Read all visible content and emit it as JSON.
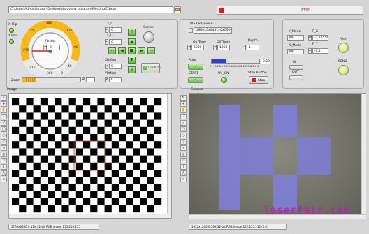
{
  "toolbar": {
    "file_path": "C:\\Users\\Administrator\\Desktop\\zhaoyang program\\Working\\C.bmp",
    "stop_label": "STOP"
  },
  "motion": {
    "x_flip_label": "X Flip",
    "y_flip_label": "Y Flip",
    "rotate_label": "Rotate",
    "rotate_value": "0",
    "dial_ticks": [
      "0",
      "45",
      "90",
      "135",
      "180",
      "225",
      "270",
      "315",
      "360"
    ],
    "zoom_label": "Zoom",
    "zoom_value": "1",
    "x_c_label": "X_C",
    "x_c_value": "0",
    "y_c_label": "Y_C",
    "y_c_value": "0",
    "center_label": "Center",
    "x_offset_label": "XOffset",
    "x_offset_value": "0",
    "y_offset_label": "YOffset",
    "y_offset_value": "0",
    "confirm_label": "Confirm"
  },
  "visa": {
    "resource_label": "VISA Resource",
    "resource_value": "USB0::0x0451::0xC900::",
    "on_time_label": "On Time",
    "on_time_value": "6000",
    "off_time_label": "Off Time",
    "off_time_value": "1000",
    "depth_label": "Depth",
    "depth_value": "1",
    "auto_label": "Auto",
    "auto_value": "0.29",
    "slider_ticks": [
      "0",
      "0.1",
      "0.2",
      "0.3",
      "0.4",
      "0.5",
      "0.6",
      "0.7",
      "0.8",
      "0.9",
      "1"
    ],
    "start_label": "START",
    "uv_on_label": "UV_ON",
    "stop_button_label": "Stop Button",
    "stop_label": "Stop",
    "auto_level": 0.29
  },
  "mode": {
    "y_mode_label": "Y_Mode",
    "y_mode_value": "MV",
    "x_mode_label": "X_Mode",
    "x_mode_value": "MV",
    "f_x_label": "F_X",
    "f_x_value": "-2.77556E",
    "f_y_label": "F_Y",
    "f_y_value": "-0.1",
    "free_label": "Free",
    "send_label": "SEND",
    "in_label": "IN",
    "out_label": "OUT"
  },
  "image_panel": {
    "title": "Image",
    "status": "5760x3240 0.11X 32-bit RGB image 255,255,255"
  },
  "camera_panel": {
    "title": "Camera",
    "status": "1920x1200 0.36X 32-bit RGB image 122,125,112    (0,0)"
  },
  "watermark": "laserfair.com"
}
